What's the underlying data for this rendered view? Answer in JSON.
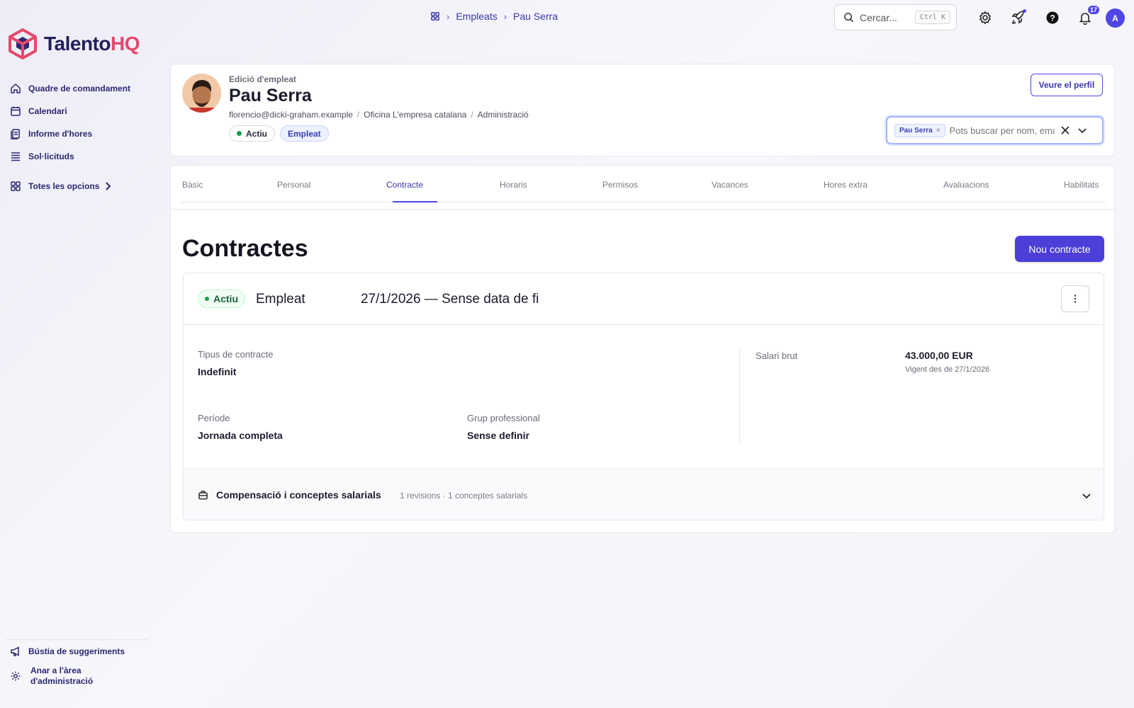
{
  "app": {
    "logo_main": "Talento",
    "logo_accent": "HQ",
    "brand_color": "#e5486b",
    "accent_color": "#4f46e5"
  },
  "sidebar": {
    "items": [
      {
        "label": "Quadre de comandament",
        "icon": "home-icon"
      },
      {
        "label": "Calendari",
        "icon": "calendar-icon"
      },
      {
        "label": "Informe d'hores",
        "icon": "report-icon"
      },
      {
        "label": "Sol·licituds",
        "icon": "list-icon"
      },
      {
        "label": "Totes les opcions",
        "icon": "grid-icon"
      }
    ],
    "bottom": [
      {
        "label": "Bústia de suggeriments",
        "icon": "megaphone-icon"
      },
      {
        "label": "Anar a l'àrea d'administració",
        "icon": "gear-icon"
      }
    ]
  },
  "topbar": {
    "breadcrumb": [
      "Empleats",
      "Pau Serra"
    ],
    "search_placeholder": "Cercar...",
    "search_shortcut": "Ctrl K",
    "notifications_count": "17",
    "avatar_initial": "A"
  },
  "employee": {
    "eyebrow": "Edició d'empleat",
    "name": "Pau Serra",
    "email": "florencio@dicki-graham.example",
    "office": "Oficina L'empresa catalana",
    "department": "Administració",
    "status": "Actiu",
    "role": "Empleat",
    "view_profile": "Veure el perfil",
    "selector_tag": "Pau Serra",
    "selector_placeholder": "Pots buscar per nom, email"
  },
  "tabs": [
    {
      "label": "Bàsic",
      "active": false
    },
    {
      "label": "Personal",
      "active": false
    },
    {
      "label": "Contracte",
      "active": true
    },
    {
      "label": "Horaris",
      "active": false
    },
    {
      "label": "Permisos",
      "active": false
    },
    {
      "label": "Vacances",
      "active": false
    },
    {
      "label": "Hores extra",
      "active": false
    },
    {
      "label": "Avaluacions",
      "active": false
    },
    {
      "label": "Habilitats",
      "active": false
    }
  ],
  "contracts": {
    "title": "Contractes",
    "new_button": "Nou contracte",
    "item": {
      "status": "Actiu",
      "role": "Empleat",
      "dates": "27/1/2026 — Sense data de fi",
      "contract_type_label": "Tipus de contracte",
      "contract_type_value": "Indefinit",
      "period_label": "Període",
      "period_value": "Jornada completa",
      "group_label": "Grup professional",
      "group_value": "Sense definir",
      "salary_label": "Salari brut",
      "salary_value": "43.000,00 EUR",
      "salary_since": "Vigent des de 27/1/2026",
      "compensation_title": "Compensació i conceptes salarials",
      "compensation_summary": "1 revisions · 1 conceptes salarials"
    }
  }
}
